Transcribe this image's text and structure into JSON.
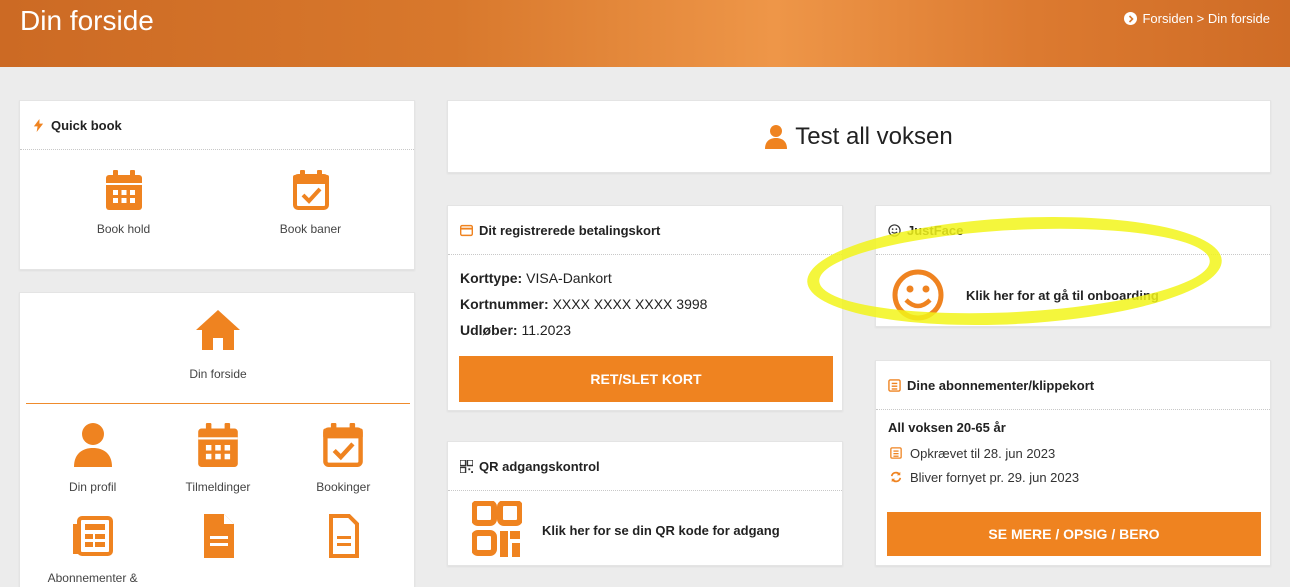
{
  "header": {
    "title": "Din forside",
    "breadcrumb": "Forsiden > Din forside"
  },
  "quickbook": {
    "title": "Quick book",
    "items": [
      {
        "label": "Book hold",
        "icon": "calendar-grid-icon"
      },
      {
        "label": "Book baner",
        "icon": "calendar-check-icon"
      }
    ]
  },
  "menu": {
    "home_label": "Din forside",
    "items": [
      {
        "label": "Din profil",
        "icon": "user-icon"
      },
      {
        "label": "Tilmeldinger",
        "icon": "calendar-grid-icon"
      },
      {
        "label": "Bookinger",
        "icon": "calendar-check-icon"
      },
      {
        "label": "Abonnementer &",
        "icon": "list-icon"
      },
      {
        "label": "",
        "icon": "document-icon"
      },
      {
        "label": "",
        "icon": "document-outline-icon"
      }
    ]
  },
  "user": {
    "name": "Test all voksen"
  },
  "payment": {
    "title": "Dit registrerede betalingskort",
    "card_type_label": "Korttype:",
    "card_type": "VISA-Dankort",
    "card_number_label": "Kortnummer:",
    "card_number": "XXXX XXXX XXXX 3998",
    "expiry_label": "Udløber:",
    "expiry": "11.2023",
    "button": "RET/SLET KORT"
  },
  "qr": {
    "title": "QR adgangskontrol",
    "text": "Klik her for se din QR kode for adgang"
  },
  "justface": {
    "title": "JustFace",
    "text": "Klik her for at gå til onboarding"
  },
  "subscriptions": {
    "title": "Dine abonnementer/klippekort",
    "plan": "All voksen 20-65 år",
    "charged": "Opkrævet til 28. jun 2023",
    "renewal": "Bliver fornyet pr. 29. jun 2023",
    "button": "SE MERE / OPSIG / BERO"
  },
  "colors": {
    "accent": "#ef8320",
    "header": "#d8782c",
    "highlight": "#f2f51a"
  }
}
